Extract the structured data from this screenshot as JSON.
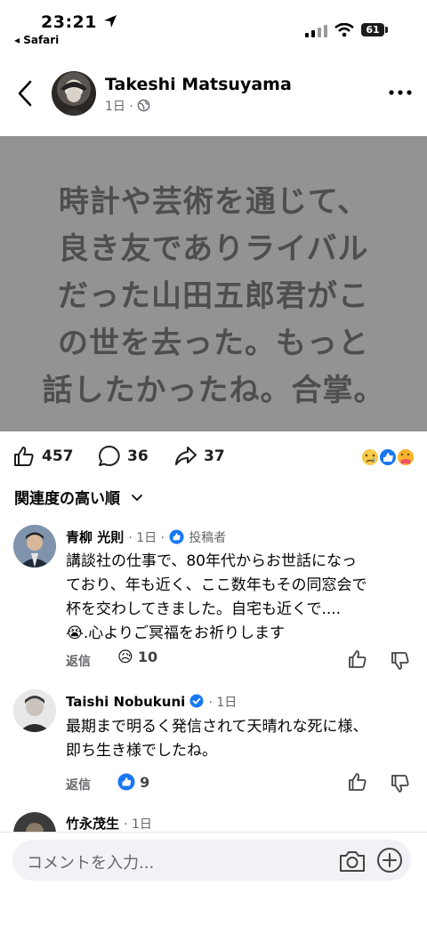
{
  "status_bar": {
    "time": "23:21",
    "back_app": "◂ Safari",
    "battery": "61"
  },
  "post": {
    "author": "Takeshi Matsuyama",
    "time": "1日 ·",
    "image_text": "時計や芸術を通じて、\n良き友でありライバル\nだった山田五郎君がこ\nの世を去った。もっと\n話したかったね。合掌。",
    "stats": {
      "likes": "457",
      "comments": "36",
      "shares": "37"
    }
  },
  "sort": {
    "label": "関連度の高い順"
  },
  "comments": [
    {
      "name": "青柳 光則",
      "time": "· 1日 ·",
      "badge": "投稿者",
      "text_lines": [
        "講談社の仕事で、80年代からお世話になっ",
        "ており、年も近く、ここ数年もその同窓会で",
        "杯を交わしてきました。自宅も近くで....",
        ".心よりご冥福をお祈りします"
      ],
      "emoji": "😭",
      "reply": "返信",
      "reaction_emoji": "😥",
      "reaction_count": "10"
    },
    {
      "name": "Taishi Nobukuni",
      "time": "· 1日",
      "text_lines": [
        "最期まで明るく発信されて天晴れな死に様、",
        "即ち生き様でしたね。"
      ],
      "reply": "返信",
      "reaction_count": "9"
    },
    {
      "name": "竹永茂生",
      "time": "· 1日"
    }
  ],
  "input": {
    "placeholder": "コメントを入力..."
  },
  "icons": {
    "back": "chevron-left-icon",
    "more": "more-dots-icon",
    "globe": "globe-icon",
    "like": "thumbs-up-icon",
    "comment": "comment-bubble-icon",
    "share": "share-arrow-icon",
    "camera": "camera-icon",
    "plus": "plus-circle-icon",
    "like_comment": "thumbs-up-outline-icon",
    "dislike_comment": "thumbs-down-outline-icon"
  },
  "colors": {
    "facebook_blue": "#1877f2",
    "image_bg": "#939393",
    "image_text": "#4e4e4e",
    "muted": "#65676b"
  }
}
